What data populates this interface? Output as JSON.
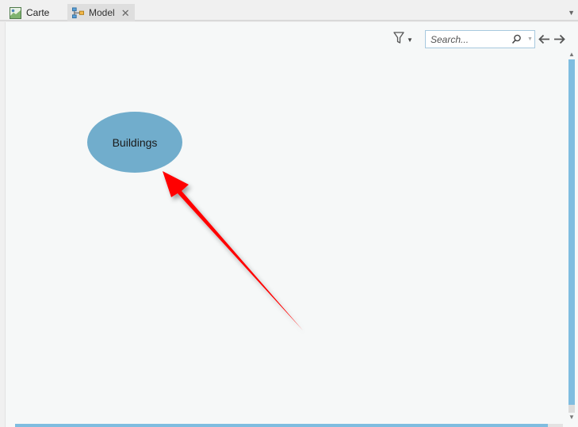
{
  "tabs": [
    {
      "label": "Carte",
      "icon": "map-icon",
      "active": false
    },
    {
      "label": "Model",
      "icon": "model-icon",
      "active": true,
      "closable": true
    }
  ],
  "toolbar": {
    "search_placeholder": "Search..."
  },
  "canvas": {
    "node_label": "Buildings"
  },
  "colors": {
    "node_fill": "#71adcc",
    "annotation_arrow": "#ff0000",
    "scrollbar": "#7fbde0",
    "canvas_bg": "#f6f8f8"
  }
}
